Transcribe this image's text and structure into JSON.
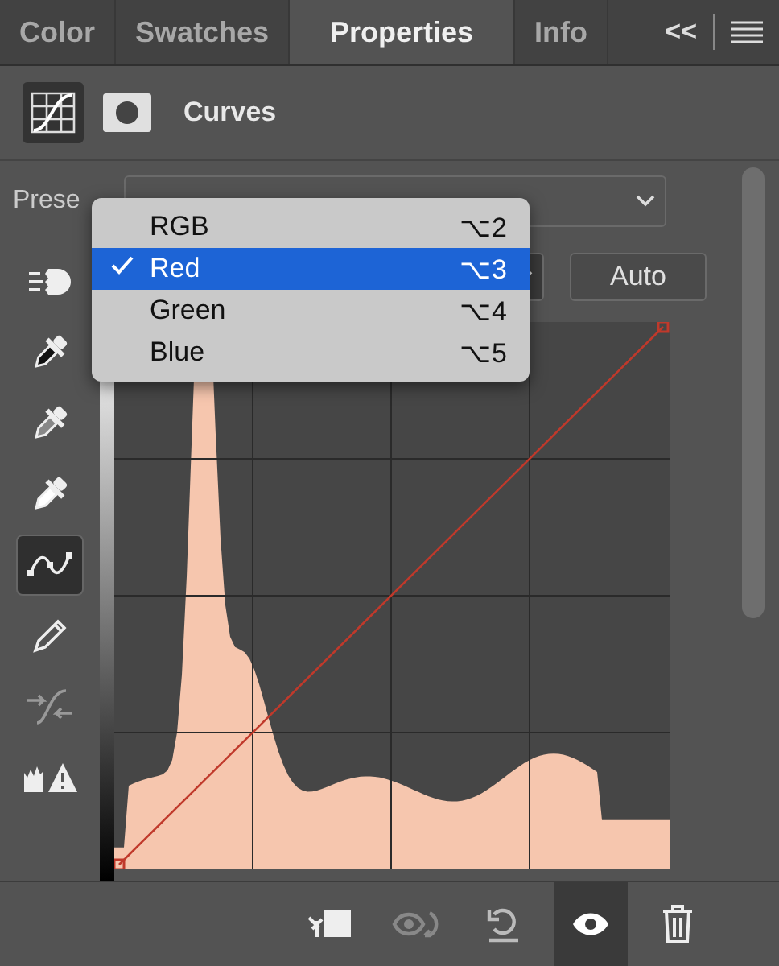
{
  "tabs": [
    {
      "label": "Color",
      "selected": false
    },
    {
      "label": "Swatches",
      "selected": false
    },
    {
      "label": "Properties",
      "selected": true
    },
    {
      "label": "Info",
      "selected": false
    }
  ],
  "collapse": "<<",
  "header": {
    "title": "Curves",
    "buttons": [
      {
        "kind": "adjustment",
        "selected": true
      },
      {
        "kind": "mask",
        "selected": false
      }
    ]
  },
  "preset_label": "Prese",
  "channel_menu": [
    {
      "label": "RGB",
      "shortcut": "⌥2",
      "selected": false
    },
    {
      "label": "Red",
      "shortcut": "⌥3",
      "selected": true
    },
    {
      "label": "Green",
      "shortcut": "⌥4",
      "selected": false
    },
    {
      "label": "Blue",
      "shortcut": "⌥5",
      "selected": false
    }
  ],
  "auto_button": "Auto",
  "tools": [
    {
      "kind": "target",
      "selected": false
    },
    {
      "kind": "dropper-black",
      "selected": false
    },
    {
      "kind": "dropper-gray",
      "selected": false
    },
    {
      "kind": "dropper-white",
      "selected": false
    },
    {
      "kind": "curve",
      "selected": true
    },
    {
      "kind": "pencil",
      "selected": false
    },
    {
      "kind": "smooth",
      "selected": false
    },
    {
      "kind": "clipping",
      "selected": false
    }
  ],
  "footer": [
    {
      "kind": "clip",
      "selected": false
    },
    {
      "kind": "previous",
      "selected": false
    },
    {
      "kind": "reset",
      "selected": false
    },
    {
      "kind": "visibility",
      "selected": true
    },
    {
      "kind": "delete",
      "selected": false
    }
  ]
}
